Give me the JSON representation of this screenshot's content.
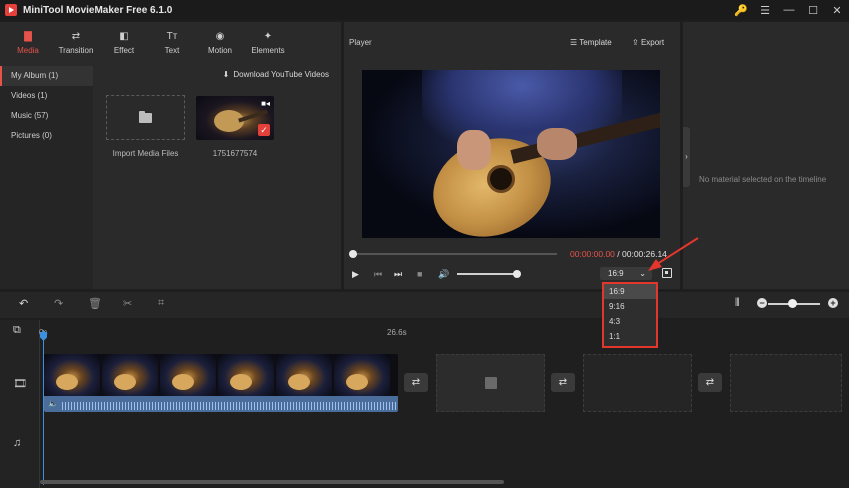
{
  "app": {
    "title": "MiniTool MovieMaker Free 6.1.0"
  },
  "window_controls": [
    "🔑",
    "☰",
    "—",
    "☐",
    "✕"
  ],
  "tabs": [
    {
      "label": "Media",
      "icon": "folder-icon",
      "glyph": "▇"
    },
    {
      "label": "Transition",
      "icon": "transition-icon",
      "glyph": "⇄"
    },
    {
      "label": "Effect",
      "icon": "effect-icon",
      "glyph": "◧"
    },
    {
      "label": "Text",
      "icon": "text-icon",
      "glyph": "Tт"
    },
    {
      "label": "Motion",
      "icon": "motion-icon",
      "glyph": "◉"
    },
    {
      "label": "Elements",
      "icon": "elements-icon",
      "glyph": "✦"
    }
  ],
  "albums": [
    "My Album (1)",
    "Videos (1)",
    "Music (57)",
    "Pictures (0)"
  ],
  "media": {
    "youtube_link": "Download YouTube Videos",
    "import_label": "Import Media Files",
    "clip_name": "1751677574"
  },
  "player": {
    "title": "Player",
    "template_label": "Template",
    "export_label": "Export",
    "current_time": "00:00:00.00",
    "separator": " / ",
    "total_time": "00:00:26.14",
    "aspect_ratio": "16:9",
    "progress": 0,
    "volume": 1.0
  },
  "properties": {
    "empty_message": "No material selected on the timeline"
  },
  "timeline": {
    "ruler_start": "0s",
    "ruler_mid": "26.6s",
    "zoom": 0.45
  },
  "aspect_dropdown": {
    "options": [
      "16:9",
      "9:16",
      "4:3",
      "1:1"
    ],
    "selected": "16:9"
  },
  "colors": {
    "accent": "#e5534b",
    "highlight": "#e3362d",
    "playhead": "#3d8fe0"
  }
}
